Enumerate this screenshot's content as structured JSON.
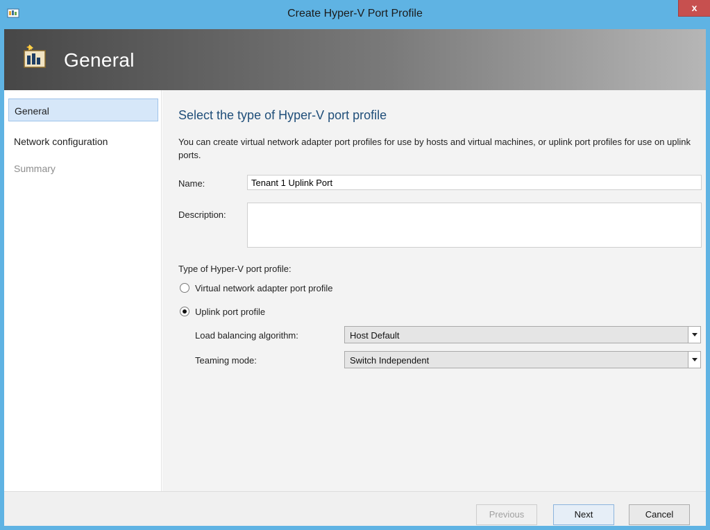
{
  "window": {
    "title": "Create Hyper-V Port Profile",
    "close_label": "x"
  },
  "banner": {
    "title": "General"
  },
  "sidebar": {
    "items": [
      {
        "label": "General",
        "state": "active"
      },
      {
        "label": "Network configuration",
        "state": "normal"
      },
      {
        "label": "Summary",
        "state": "disabled"
      }
    ]
  },
  "main": {
    "heading": "Select the type of Hyper-V port profile",
    "intro": "You can create virtual network adapter port profiles for use by hosts and virtual machines, or uplink port profiles for use on uplink ports.",
    "name_label": "Name:",
    "name_value": "Tenant 1 Uplink Port",
    "description_label": "Description:",
    "description_value": "",
    "type_label": "Type of Hyper-V port profile:",
    "options": [
      {
        "label": "Virtual network adapter port profile",
        "checked": false
      },
      {
        "label": "Uplink port profile",
        "checked": true
      }
    ],
    "load_balancing_label": "Load balancing algorithm:",
    "load_balancing_value": "Host Default",
    "teaming_label": "Teaming mode:",
    "teaming_value": "Switch Independent"
  },
  "footer": {
    "previous_label": "Previous",
    "next_label": "Next",
    "cancel_label": "Cancel"
  },
  "colors": {
    "frame": "#5fb3e3",
    "close": "#c7504f",
    "heading": "#1f4e79",
    "nav_active": "#d6e7f9"
  }
}
